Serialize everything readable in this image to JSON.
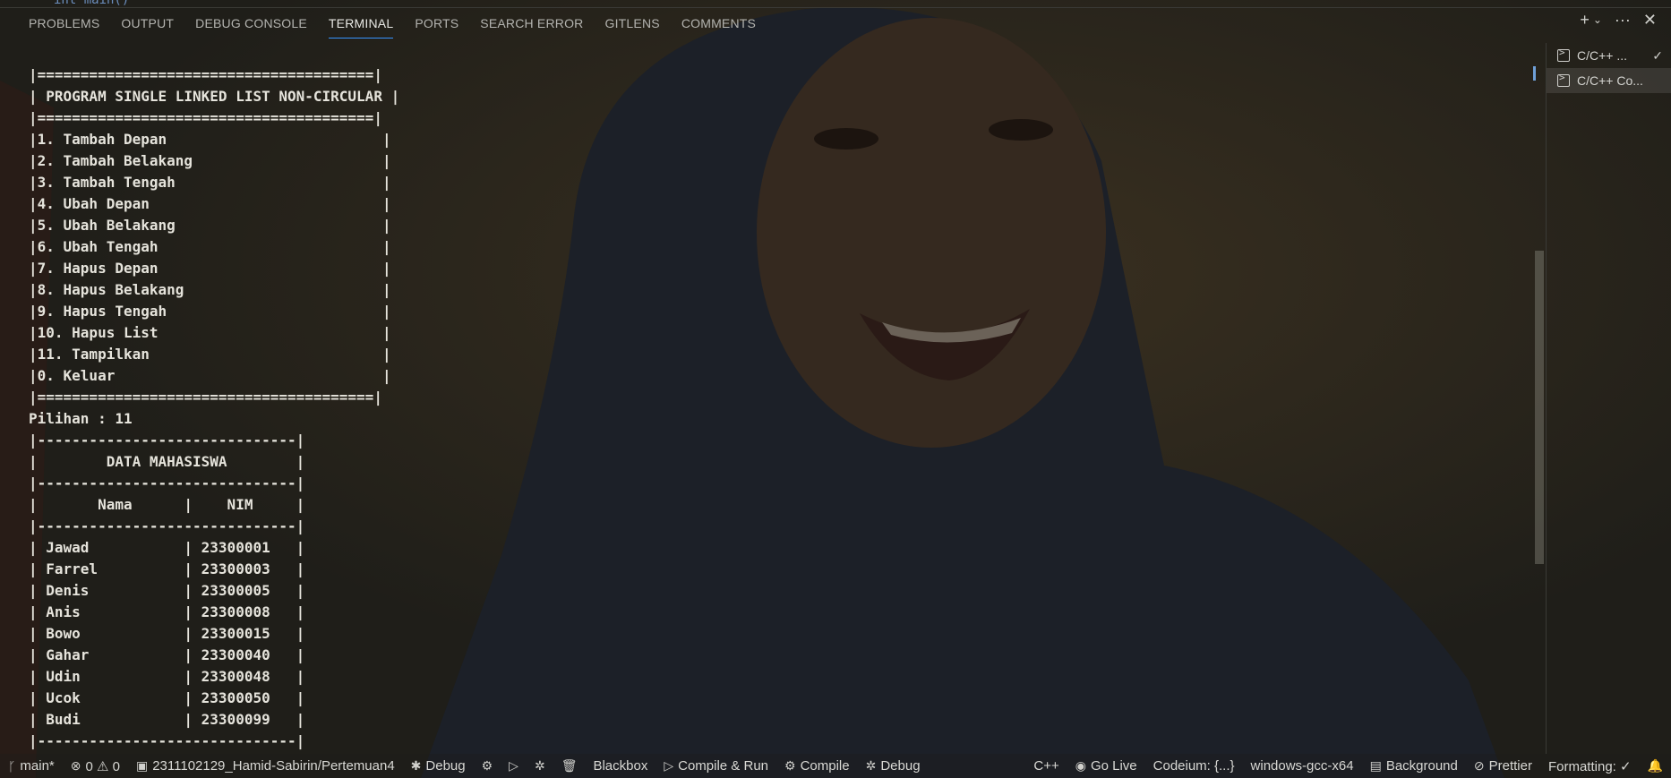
{
  "editor_peek": "int main()",
  "panel": {
    "tabs": [
      {
        "label": "PROBLEMS"
      },
      {
        "label": "OUTPUT"
      },
      {
        "label": "DEBUG CONSOLE"
      },
      {
        "label": "TERMINAL",
        "active": true
      },
      {
        "label": "PORTS"
      },
      {
        "label": "SEARCH ERROR"
      },
      {
        "label": "GITLENS"
      },
      {
        "label": "COMMENTS"
      }
    ],
    "actions": {
      "new_terminal": "+",
      "dropdown": "⌄",
      "more": "···",
      "close": "✕"
    }
  },
  "terminals": [
    {
      "label": "C/C++ ...",
      "icon": "terminal-icon",
      "status": "✓"
    },
    {
      "label": "C/C++ Co...",
      "icon": "terminal-icon",
      "active": true
    }
  ],
  "terminal_lines": [
    "|=======================================|",
    "| PROGRAM SINGLE LINKED LIST NON-CIRCULAR |",
    "|=======================================|",
    "|1. Tambah Depan                         |",
    "|2. Tambah Belakang                      |",
    "|3. Tambah Tengah                        |",
    "|4. Ubah Depan                           |",
    "|5. Ubah Belakang                        |",
    "|6. Ubah Tengah                          |",
    "|7. Hapus Depan                          |",
    "|8. Hapus Belakang                       |",
    "|9. Hapus Tengah                         |",
    "|10. Hapus List                          |",
    "|11. Tampilkan                           |",
    "|0. Keluar                               |",
    "|=======================================|",
    "Pilihan : 11",
    "|------------------------------|",
    "|        DATA MAHASISWA        |",
    "|------------------------------|",
    "|       Nama      |    NIM     |",
    "|------------------------------|",
    "| Jawad           | 23300001   |",
    "| Farrel          | 23300003   |",
    "| Denis           | 23300005   |",
    "| Anis            | 23300008   |",
    "| Bowo            | 23300015   |",
    "| Gahar           | 23300040   |",
    "| Udin            | 23300048   |",
    "| Ucok            | 23300050   |",
    "| Budi            | 23300099   |",
    "|------------------------------|"
  ],
  "status_bar": {
    "left": [
      {
        "icon": "ᚴ",
        "icon_name": "git-branch-icon",
        "label": "main*"
      },
      {
        "icon": "⊗",
        "icon_name": "error-icon",
        "label": "0 ⚠ 0"
      },
      {
        "icon": "▣",
        "icon_name": "folder-icon",
        "label": "2311102129_Hamid-Sabirin/Pertemuan4"
      },
      {
        "icon": "✱",
        "icon_name": "tools-icon",
        "label": "Debug"
      },
      {
        "icon": "⚙",
        "icon_name": "gear-icon",
        "label": ""
      },
      {
        "icon": "▷",
        "icon_name": "play-icon",
        "label": ""
      },
      {
        "icon": "✲",
        "icon_name": "bug-icon",
        "label": ""
      },
      {
        "icon": "🗑",
        "icon_name": "trash-icon",
        "label": ""
      },
      {
        "icon": "",
        "icon_name": "",
        "label": "Blackbox"
      },
      {
        "icon": "▷",
        "icon_name": "play-icon",
        "label": "Compile & Run"
      },
      {
        "icon": "⚙",
        "icon_name": "gear-icon",
        "label": "Compile"
      },
      {
        "icon": "✲",
        "icon_name": "bug-icon",
        "label": "Debug"
      }
    ],
    "right": [
      {
        "icon": "",
        "icon_name": "",
        "label": "C++"
      },
      {
        "icon": "◉",
        "icon_name": "broadcast-icon",
        "label": "Go Live"
      },
      {
        "icon": "",
        "icon_name": "",
        "label": "Codeium: {...}"
      },
      {
        "icon": "",
        "icon_name": "",
        "label": "windows-gcc-x64"
      },
      {
        "icon": "▤",
        "icon_name": "background-icon",
        "label": "Background"
      },
      {
        "icon": "⊘",
        "icon_name": "prettier-icon",
        "label": "Prettier"
      },
      {
        "icon": "",
        "icon_name": "",
        "label": "Formatting: ✓"
      },
      {
        "icon": "🔔",
        "icon_name": "bell-icon",
        "label": ""
      }
    ]
  }
}
